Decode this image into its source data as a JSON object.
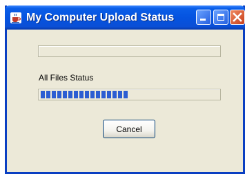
{
  "window": {
    "title": "My Computer Upload Status",
    "icon": "java-coffee-cup-icon"
  },
  "title_buttons": {
    "minimize": "minimize-icon",
    "maximize": "maximize-icon",
    "close": "close-icon"
  },
  "current_file": {
    "progress": 0.0
  },
  "all_files": {
    "label": "All Files Status",
    "progress": 0.5
  },
  "cancel_button": {
    "label": "Cancel"
  },
  "colors": {
    "title_bar": "#0553e0",
    "progress_fill": "#2c5ed2",
    "dialog_background": "#ece9d8",
    "close_button": "#c8401c"
  }
}
